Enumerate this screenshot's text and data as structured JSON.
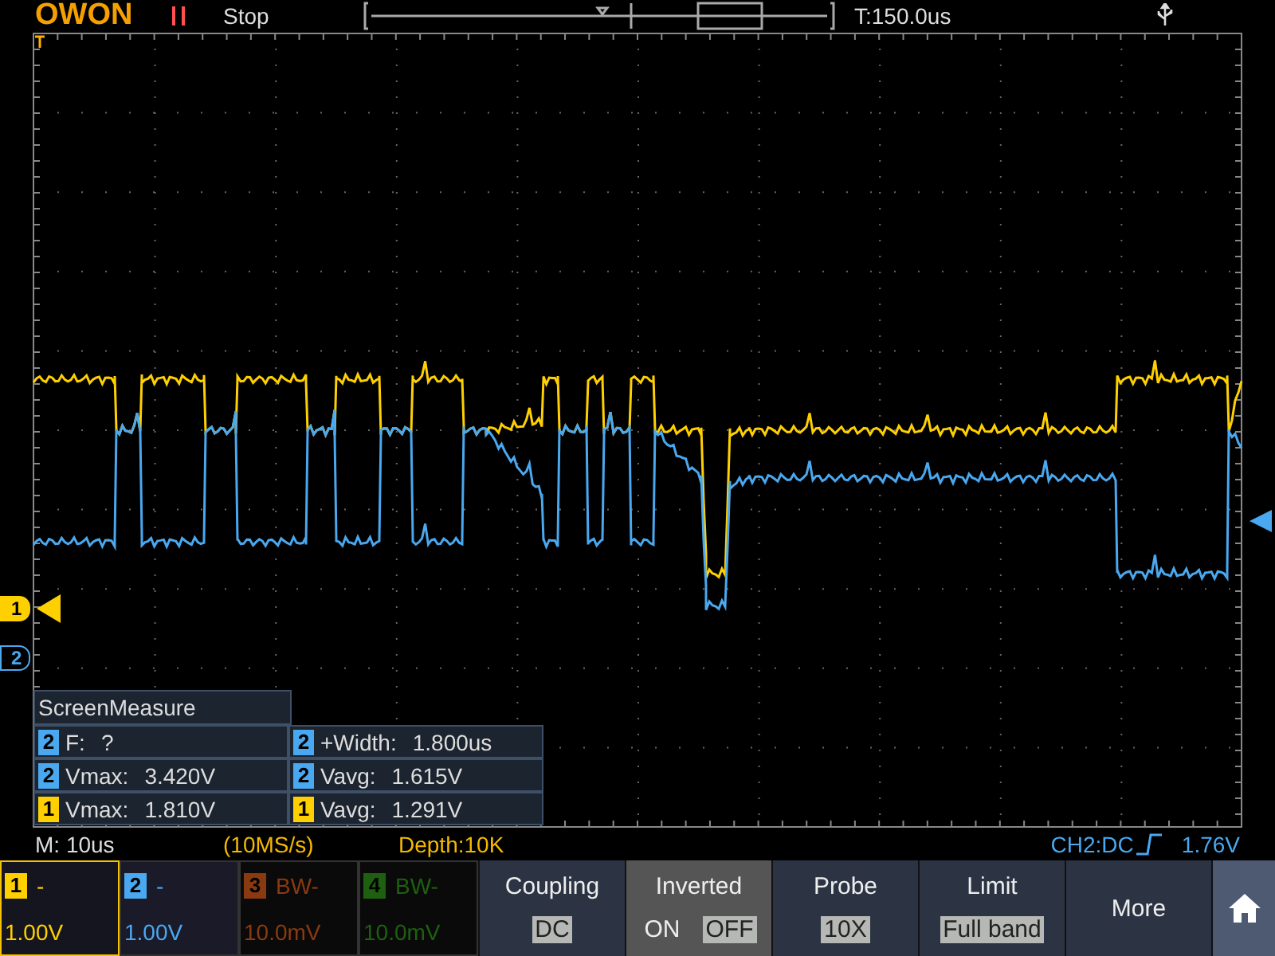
{
  "header": {
    "logo": "OWON",
    "run_state": "Stop",
    "time_offset": "T:150.0us"
  },
  "measure_panel": {
    "title": "ScreenMeasure",
    "items": [
      {
        "channel": "2",
        "color": "#4aa8f0",
        "label": "F:",
        "value": "?"
      },
      {
        "channel": "2",
        "color": "#4aa8f0",
        "label": "+Width:",
        "value": "1.800us"
      },
      {
        "channel": "2",
        "color": "#4aa8f0",
        "label": "Vmax:",
        "value": "3.420V"
      },
      {
        "channel": "2",
        "color": "#4aa8f0",
        "label": "Vavg:",
        "value": "1.615V"
      },
      {
        "channel": "1",
        "color": "#ffd000",
        "label": "Vmax:",
        "value": "1.810V"
      },
      {
        "channel": "1",
        "color": "#ffd000",
        "label": "Vavg:",
        "value": "1.291V"
      }
    ]
  },
  "channel_markers": [
    {
      "label": "1",
      "color": "#ffd000"
    },
    {
      "label": "2",
      "color": "#4aa8f0"
    }
  ],
  "info_bar": {
    "timebase": "M: 10us",
    "sample_rate": "(10MS/s)",
    "depth": "Depth:10K",
    "trigger": "CH2:DC",
    "trigger_level": "1.76V"
  },
  "channels": [
    {
      "number": "1",
      "label": "-",
      "scale": "1.00V",
      "color": "#ffd000",
      "selected": true,
      "enabled": true
    },
    {
      "number": "2",
      "label": "-",
      "scale": "1.00V",
      "color": "#4aa8f0",
      "selected": false,
      "enabled": true
    },
    {
      "number": "3",
      "label": "BW-",
      "scale": "10.0mV",
      "color": "#8a3a10",
      "selected": false,
      "enabled": false
    },
    {
      "number": "4",
      "label": "BW-",
      "scale": "10.0mV",
      "color": "#1e6010",
      "selected": false,
      "enabled": false
    }
  ],
  "menu": [
    {
      "kind": "option",
      "title": "Coupling",
      "selected": false,
      "options": [
        {
          "label": "DC",
          "selected": true
        }
      ]
    },
    {
      "kind": "option",
      "title": "Inverted",
      "selected": true,
      "options": [
        {
          "label": "ON",
          "selected": false
        },
        {
          "label": "OFF",
          "selected": true
        }
      ]
    },
    {
      "kind": "option",
      "title": "Probe",
      "selected": false,
      "options": [
        {
          "label": "10X",
          "selected": true
        }
      ]
    },
    {
      "kind": "option",
      "title": "Limit",
      "selected": false,
      "options": [
        {
          "label": "Full band",
          "selected": true
        }
      ]
    },
    {
      "kind": "action",
      "title": "More",
      "selected": false
    },
    {
      "kind": "home"
    }
  ]
}
